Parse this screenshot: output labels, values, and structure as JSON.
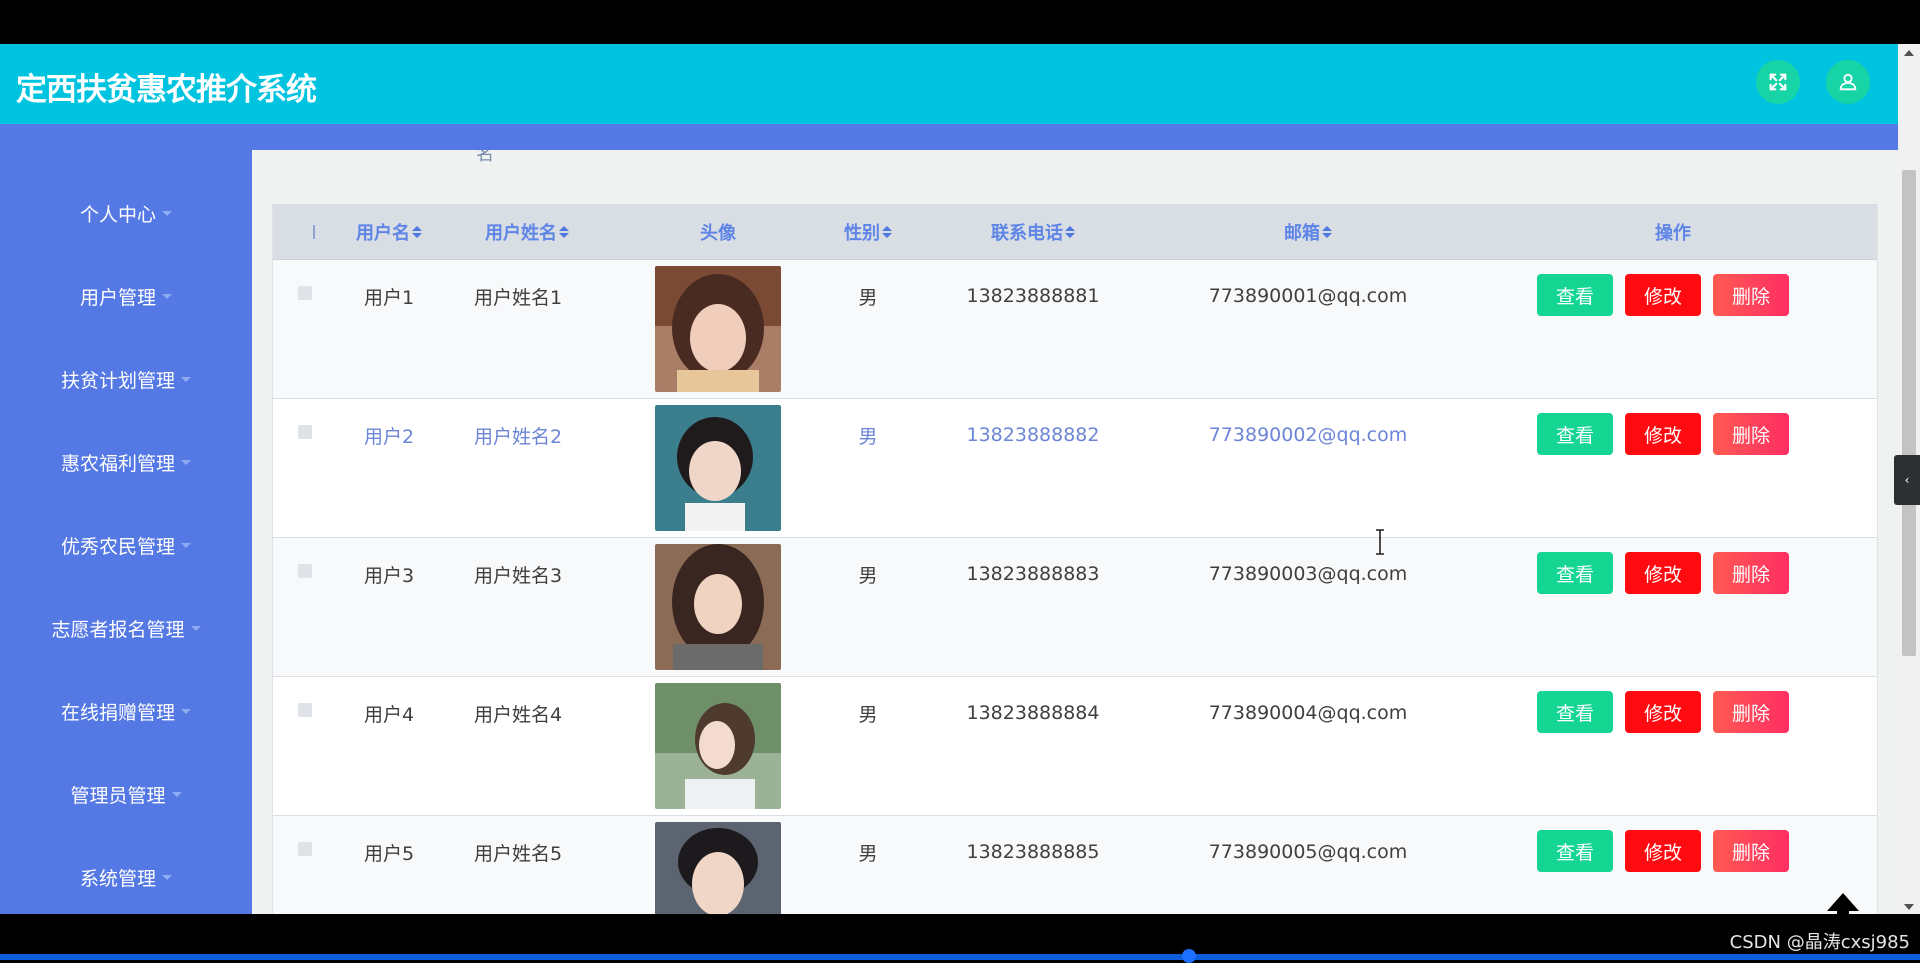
{
  "app": {
    "title": "定西扶贫惠农推介系统",
    "accent": "#00c3df",
    "sidebar_color": "#5478e4"
  },
  "header": {
    "fullscreen_icon": "fullscreen-icon",
    "user_icon": "user-icon"
  },
  "sidebar": {
    "items": [
      {
        "label": "个人中心"
      },
      {
        "label": "用户管理"
      },
      {
        "label": "扶贫计划管理"
      },
      {
        "label": "惠农福利管理"
      },
      {
        "label": "优秀农民管理"
      },
      {
        "label": "志愿者报名管理"
      },
      {
        "label": "在线捐赠管理"
      },
      {
        "label": "管理员管理"
      },
      {
        "label": "系统管理"
      }
    ]
  },
  "content": {
    "cut_label": "名"
  },
  "table": {
    "columns": {
      "username": "用户名",
      "realname": "用户姓名",
      "avatar": "头像",
      "gender": "性别",
      "phone": "联系电话",
      "email": "邮箱",
      "actions": "操作"
    },
    "buttons": {
      "view": "查看",
      "edit": "修改",
      "delete": "删除"
    },
    "rows": [
      {
        "username": "用户1",
        "realname": "用户姓名1",
        "gender": "男",
        "phone": "13823888881",
        "email": "773890001@qq.com"
      },
      {
        "username": "用户2",
        "realname": "用户姓名2",
        "gender": "男",
        "phone": "13823888882",
        "email": "773890002@qq.com"
      },
      {
        "username": "用户3",
        "realname": "用户姓名3",
        "gender": "男",
        "phone": "13823888883",
        "email": "773890003@qq.com"
      },
      {
        "username": "用户4",
        "realname": "用户姓名4",
        "gender": "男",
        "phone": "13823888884",
        "email": "773890004@qq.com"
      },
      {
        "username": "用户5",
        "realname": "用户姓名5",
        "gender": "男",
        "phone": "13823888885",
        "email": "773890005@qq.com"
      }
    ]
  },
  "watermark": "CSDN @晶涛cxsj985"
}
